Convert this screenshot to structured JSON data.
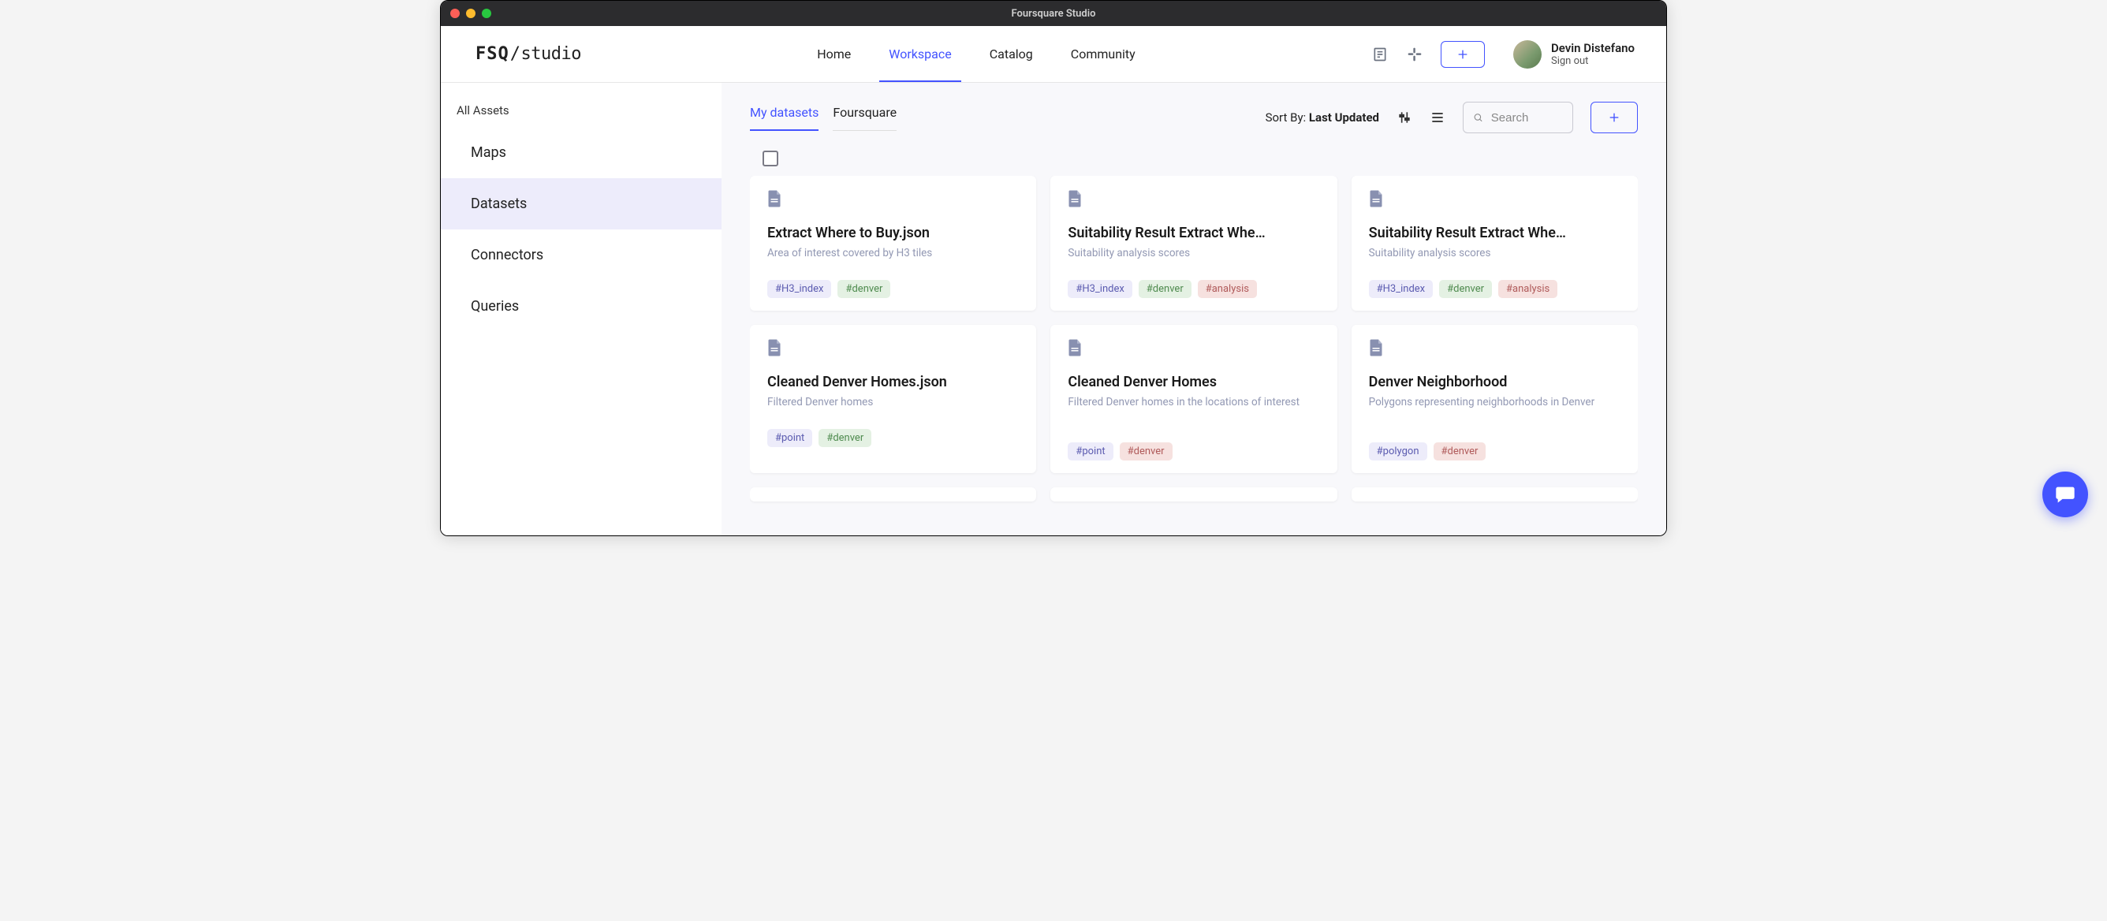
{
  "window": {
    "title": "Foursquare Studio"
  },
  "logo": {
    "left": "FSQ",
    "slash": "/",
    "right": "studio"
  },
  "nav": [
    {
      "label": "Home",
      "active": false
    },
    {
      "label": "Workspace",
      "active": true
    },
    {
      "label": "Catalog",
      "active": false
    },
    {
      "label": "Community",
      "active": false
    }
  ],
  "user": {
    "name": "Devin Distefano",
    "signout": "Sign out"
  },
  "sidebar": {
    "heading": "All Assets",
    "items": [
      {
        "label": "Maps",
        "active": false
      },
      {
        "label": "Datasets",
        "active": true
      },
      {
        "label": "Connectors",
        "active": false
      },
      {
        "label": "Queries",
        "active": false
      }
    ]
  },
  "subtabs": [
    {
      "label": "My datasets",
      "active": true
    },
    {
      "label": "Foursquare",
      "active": false
    }
  ],
  "sort": {
    "label": "Sort By: ",
    "value": "Last Updated"
  },
  "search": {
    "placeholder": "Search"
  },
  "cards": [
    {
      "title": "Extract Where to Buy.json",
      "desc": "Area of interest covered by H3 tiles",
      "tags": [
        {
          "text": "#H3_index",
          "cls": "purple"
        },
        {
          "text": "#denver",
          "cls": "green"
        }
      ]
    },
    {
      "title": "Suitability Result Extract Whe…",
      "desc": "Suitability analysis scores",
      "tags": [
        {
          "text": "#H3_index",
          "cls": "purple"
        },
        {
          "text": "#denver",
          "cls": "green"
        },
        {
          "text": "#analysis",
          "cls": "red"
        }
      ]
    },
    {
      "title": "Suitability Result Extract Whe…",
      "desc": "Suitability analysis scores",
      "tags": [
        {
          "text": "#H3_index",
          "cls": "purple"
        },
        {
          "text": "#denver",
          "cls": "green"
        },
        {
          "text": "#analysis",
          "cls": "red"
        }
      ]
    },
    {
      "title": "Cleaned Denver Homes.json",
      "desc": "Filtered Denver homes",
      "tags": [
        {
          "text": "#point",
          "cls": "purple"
        },
        {
          "text": "#denver",
          "cls": "green"
        }
      ]
    },
    {
      "title": "Cleaned Denver Homes",
      "desc": "Filtered Denver homes in the locations of interest",
      "tags": [
        {
          "text": "#point",
          "cls": "purple"
        },
        {
          "text": "#denver",
          "cls": "red"
        }
      ],
      "twoLine": true
    },
    {
      "title": "Denver Neighborhood",
      "desc": "Polygons representing neighborhoods in Denver",
      "tags": [
        {
          "text": "#polygon",
          "cls": "purple"
        },
        {
          "text": "#denver",
          "cls": "red"
        }
      ],
      "twoLine": true
    }
  ]
}
